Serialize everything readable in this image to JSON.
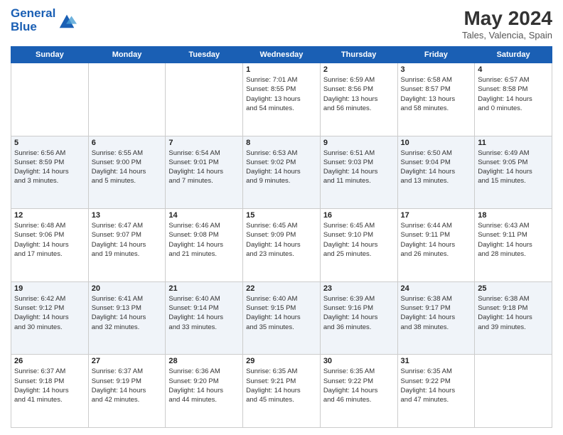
{
  "logo": {
    "line1": "General",
    "line2": "Blue"
  },
  "title": {
    "month_year": "May 2024",
    "location": "Tales, Valencia, Spain"
  },
  "weekdays": [
    "Sunday",
    "Monday",
    "Tuesday",
    "Wednesday",
    "Thursday",
    "Friday",
    "Saturday"
  ],
  "weeks": [
    [
      {
        "day": "",
        "info": ""
      },
      {
        "day": "",
        "info": ""
      },
      {
        "day": "",
        "info": ""
      },
      {
        "day": "1",
        "info": "Sunrise: 7:01 AM\nSunset: 8:55 PM\nDaylight: 13 hours\nand 54 minutes."
      },
      {
        "day": "2",
        "info": "Sunrise: 6:59 AM\nSunset: 8:56 PM\nDaylight: 13 hours\nand 56 minutes."
      },
      {
        "day": "3",
        "info": "Sunrise: 6:58 AM\nSunset: 8:57 PM\nDaylight: 13 hours\nand 58 minutes."
      },
      {
        "day": "4",
        "info": "Sunrise: 6:57 AM\nSunset: 8:58 PM\nDaylight: 14 hours\nand 0 minutes."
      }
    ],
    [
      {
        "day": "5",
        "info": "Sunrise: 6:56 AM\nSunset: 8:59 PM\nDaylight: 14 hours\nand 3 minutes."
      },
      {
        "day": "6",
        "info": "Sunrise: 6:55 AM\nSunset: 9:00 PM\nDaylight: 14 hours\nand 5 minutes."
      },
      {
        "day": "7",
        "info": "Sunrise: 6:54 AM\nSunset: 9:01 PM\nDaylight: 14 hours\nand 7 minutes."
      },
      {
        "day": "8",
        "info": "Sunrise: 6:53 AM\nSunset: 9:02 PM\nDaylight: 14 hours\nand 9 minutes."
      },
      {
        "day": "9",
        "info": "Sunrise: 6:51 AM\nSunset: 9:03 PM\nDaylight: 14 hours\nand 11 minutes."
      },
      {
        "day": "10",
        "info": "Sunrise: 6:50 AM\nSunset: 9:04 PM\nDaylight: 14 hours\nand 13 minutes."
      },
      {
        "day": "11",
        "info": "Sunrise: 6:49 AM\nSunset: 9:05 PM\nDaylight: 14 hours\nand 15 minutes."
      }
    ],
    [
      {
        "day": "12",
        "info": "Sunrise: 6:48 AM\nSunset: 9:06 PM\nDaylight: 14 hours\nand 17 minutes."
      },
      {
        "day": "13",
        "info": "Sunrise: 6:47 AM\nSunset: 9:07 PM\nDaylight: 14 hours\nand 19 minutes."
      },
      {
        "day": "14",
        "info": "Sunrise: 6:46 AM\nSunset: 9:08 PM\nDaylight: 14 hours\nand 21 minutes."
      },
      {
        "day": "15",
        "info": "Sunrise: 6:45 AM\nSunset: 9:09 PM\nDaylight: 14 hours\nand 23 minutes."
      },
      {
        "day": "16",
        "info": "Sunrise: 6:45 AM\nSunset: 9:10 PM\nDaylight: 14 hours\nand 25 minutes."
      },
      {
        "day": "17",
        "info": "Sunrise: 6:44 AM\nSunset: 9:11 PM\nDaylight: 14 hours\nand 26 minutes."
      },
      {
        "day": "18",
        "info": "Sunrise: 6:43 AM\nSunset: 9:11 PM\nDaylight: 14 hours\nand 28 minutes."
      }
    ],
    [
      {
        "day": "19",
        "info": "Sunrise: 6:42 AM\nSunset: 9:12 PM\nDaylight: 14 hours\nand 30 minutes."
      },
      {
        "day": "20",
        "info": "Sunrise: 6:41 AM\nSunset: 9:13 PM\nDaylight: 14 hours\nand 32 minutes."
      },
      {
        "day": "21",
        "info": "Sunrise: 6:40 AM\nSunset: 9:14 PM\nDaylight: 14 hours\nand 33 minutes."
      },
      {
        "day": "22",
        "info": "Sunrise: 6:40 AM\nSunset: 9:15 PM\nDaylight: 14 hours\nand 35 minutes."
      },
      {
        "day": "23",
        "info": "Sunrise: 6:39 AM\nSunset: 9:16 PM\nDaylight: 14 hours\nand 36 minutes."
      },
      {
        "day": "24",
        "info": "Sunrise: 6:38 AM\nSunset: 9:17 PM\nDaylight: 14 hours\nand 38 minutes."
      },
      {
        "day": "25",
        "info": "Sunrise: 6:38 AM\nSunset: 9:18 PM\nDaylight: 14 hours\nand 39 minutes."
      }
    ],
    [
      {
        "day": "26",
        "info": "Sunrise: 6:37 AM\nSunset: 9:18 PM\nDaylight: 14 hours\nand 41 minutes."
      },
      {
        "day": "27",
        "info": "Sunrise: 6:37 AM\nSunset: 9:19 PM\nDaylight: 14 hours\nand 42 minutes."
      },
      {
        "day": "28",
        "info": "Sunrise: 6:36 AM\nSunset: 9:20 PM\nDaylight: 14 hours\nand 44 minutes."
      },
      {
        "day": "29",
        "info": "Sunrise: 6:35 AM\nSunset: 9:21 PM\nDaylight: 14 hours\nand 45 minutes."
      },
      {
        "day": "30",
        "info": "Sunrise: 6:35 AM\nSunset: 9:22 PM\nDaylight: 14 hours\nand 46 minutes."
      },
      {
        "day": "31",
        "info": "Sunrise: 6:35 AM\nSunset: 9:22 PM\nDaylight: 14 hours\nand 47 minutes."
      },
      {
        "day": "",
        "info": ""
      }
    ]
  ]
}
